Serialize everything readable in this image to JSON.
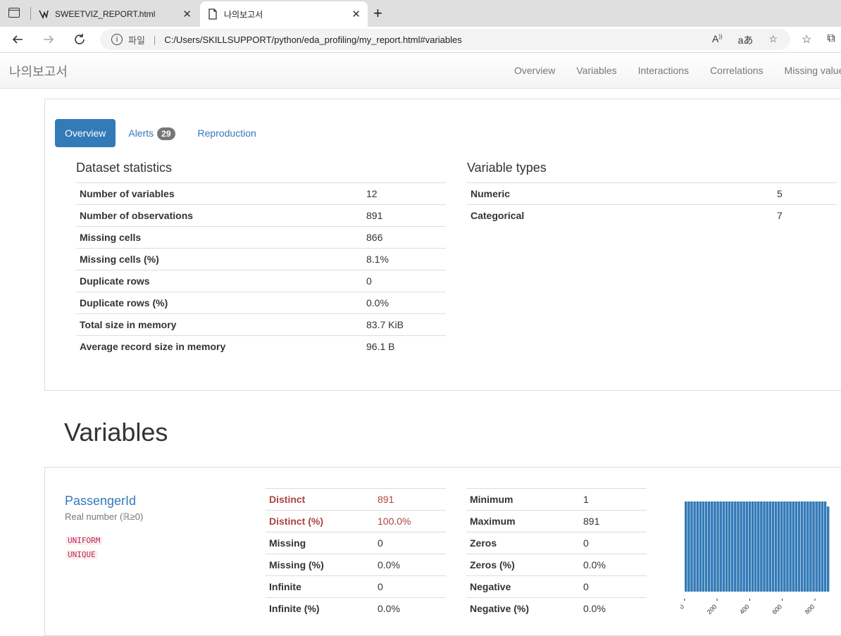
{
  "browser": {
    "tabs": [
      {
        "title": "SWEETVIZ_REPORT.html",
        "active": false
      },
      {
        "title": "나의보고서",
        "active": true
      }
    ],
    "address": {
      "scheme": "파일",
      "url": "C:/Users/SKILLSUPPORT/python/eda_profiling/my_report.html#variables"
    }
  },
  "page": {
    "brand": "나의보고서",
    "nav": [
      "Overview",
      "Variables",
      "Interactions",
      "Correlations",
      "Missing values"
    ]
  },
  "overview": {
    "tabs": {
      "overview": "Overview",
      "alerts": "Alerts",
      "alerts_count": "29",
      "reproduction": "Reproduction"
    },
    "dataset_title": "Dataset statistics",
    "dataset_stats": [
      {
        "k": "Number of variables",
        "v": "12"
      },
      {
        "k": "Number of observations",
        "v": "891"
      },
      {
        "k": "Missing cells",
        "v": "866"
      },
      {
        "k": "Missing cells (%)",
        "v": "8.1%"
      },
      {
        "k": "Duplicate rows",
        "v": "0"
      },
      {
        "k": "Duplicate rows (%)",
        "v": "0.0%"
      },
      {
        "k": "Total size in memory",
        "v": "83.7 KiB"
      },
      {
        "k": "Average record size in memory",
        "v": "96.1 B"
      }
    ],
    "types_title": "Variable types",
    "types": [
      {
        "k": "Numeric",
        "v": "5"
      },
      {
        "k": "Categorical",
        "v": "7"
      }
    ]
  },
  "variables": {
    "title": "Variables",
    "var1": {
      "name": "PassengerId",
      "type": "Real number (ℝ≥0)",
      "tags": [
        "UNIFORM",
        "UNIQUE"
      ],
      "stats_left": [
        {
          "k": "Distinct",
          "v": "891"
        },
        {
          "k": "Distinct (%)",
          "v": "100.0%"
        },
        {
          "k": "Missing",
          "v": "0"
        },
        {
          "k": "Missing (%)",
          "v": "0.0%"
        },
        {
          "k": "Infinite",
          "v": "0"
        },
        {
          "k": "Infinite (%)",
          "v": "0.0%"
        }
      ],
      "stats_right": [
        {
          "k": "Minimum",
          "v": "1"
        },
        {
          "k": "Maximum",
          "v": "891"
        },
        {
          "k": "Zeros",
          "v": "0"
        },
        {
          "k": "Zeros (%)",
          "v": "0.0%"
        },
        {
          "k": "Negative",
          "v": "0"
        },
        {
          "k": "Negative (%)",
          "v": "0.0%"
        }
      ],
      "histogram": {
        "color": "#337ab7",
        "x_ticks": [
          "0",
          "200",
          "400",
          "600",
          "800"
        ],
        "xlim": [
          1,
          891
        ],
        "bins": 50,
        "uniform_count": 18
      }
    }
  }
}
